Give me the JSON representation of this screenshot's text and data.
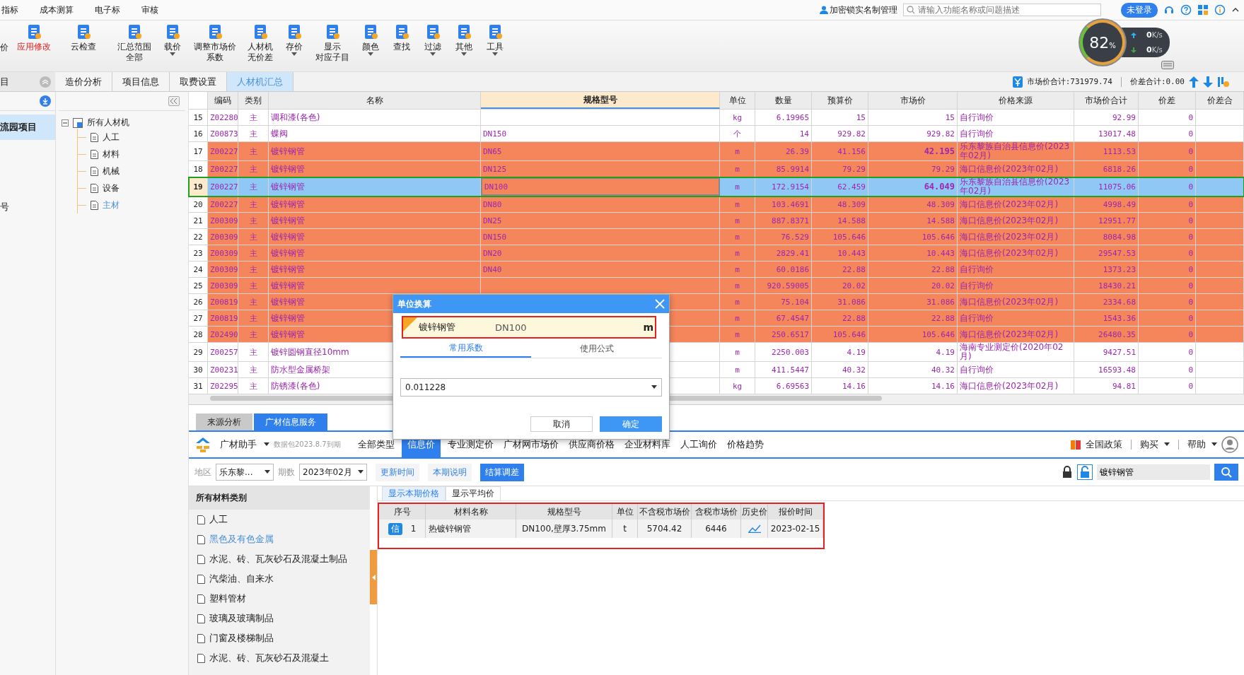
{
  "menu": [
    {
      "label": "指标"
    },
    {
      "label": "成本测算"
    },
    {
      "label": "电子标"
    },
    {
      "label": "审核"
    }
  ],
  "top_right": {
    "account": "加密锁实名制管理",
    "search_placeholder": "请输入功能名称或问题描述",
    "login": "未登录"
  },
  "toolbar": [
    {
      "lines": [
        "价"
      ],
      "active": false,
      "dropdown": false,
      "cut": true
    },
    {
      "lines": [
        "应用修改"
      ],
      "active": true,
      "dropdown": false,
      "cut": false
    },
    {
      "lines": [
        "云检查"
      ],
      "active": false,
      "dropdown": false,
      "cut": false
    },
    {
      "lines": [
        "汇总范围",
        "全部"
      ],
      "active": false,
      "dropdown": false,
      "cut": false
    },
    {
      "lines": [
        "载价"
      ],
      "active": false,
      "dropdown": true,
      "cut": false
    },
    {
      "lines": [
        "调整市场价",
        "系数"
      ],
      "active": false,
      "dropdown": false,
      "cut": false
    },
    {
      "lines": [
        "人材机",
        "无价差"
      ],
      "active": false,
      "dropdown": false,
      "cut": false
    },
    {
      "lines": [
        "存价"
      ],
      "active": false,
      "dropdown": true,
      "cut": false
    },
    {
      "lines": [
        "显示",
        "对应子目"
      ],
      "active": false,
      "dropdown": false,
      "cut": false
    },
    {
      "lines": [
        "颜色"
      ],
      "active": false,
      "dropdown": true,
      "cut": false
    },
    {
      "lines": [
        "查找"
      ],
      "active": false,
      "dropdown": false,
      "cut": false
    },
    {
      "lines": [
        "过滤"
      ],
      "active": false,
      "dropdown": true,
      "cut": false
    },
    {
      "lines": [
        "其他"
      ],
      "active": false,
      "dropdown": true,
      "cut": false
    },
    {
      "lines": [
        "工具"
      ],
      "active": false,
      "dropdown": true,
      "cut": false
    }
  ],
  "monitor": {
    "percent": "82",
    "percent_unit": "%",
    "upload": "0",
    "upload_unit": "K/s",
    "download": "0",
    "download_unit": "K/s"
  },
  "nav": {
    "header": "目",
    "selected_item": "流园项目",
    "other_item": "号"
  },
  "tabs": [
    {
      "label": "造价分析",
      "selected": false
    },
    {
      "label": "项目信息",
      "selected": false
    },
    {
      "label": "取费设置",
      "selected": false
    },
    {
      "label": "人材机汇总",
      "selected": true
    }
  ],
  "totals": {
    "market_total": "市场价合计:731979.74",
    "diff_total": "价差合计:0.00"
  },
  "tree": {
    "label": "所有人材机",
    "expanded": true,
    "children": [
      {
        "label": "人工",
        "selected": false
      },
      {
        "label": "材料",
        "selected": false
      },
      {
        "label": "机械",
        "selected": false
      },
      {
        "label": "设备",
        "selected": false
      },
      {
        "label": "主材",
        "selected": true
      }
    ]
  },
  "table": {
    "columns": [
      "编码",
      "类别",
      "名称",
      "规格型号",
      "单位",
      "数量",
      "预算价",
      "市场价",
      "价格来源",
      "市场价合计",
      "价差",
      "价差合"
    ],
    "rows": [
      {
        "no": "15",
        "code": "Z02280",
        "type": "主",
        "name": "调和漆(各色)",
        "unit": "kg",
        "qty": "6.19965",
        "budget": "15",
        "market": "15",
        "source": "自行询价",
        "total": "92.99",
        "diff": "0",
        "highlighted": false,
        "selected": false,
        "market_bold": false
      },
      {
        "no": "16",
        "code": "Z00873",
        "type": "主",
        "name": "蝶阀",
        "spec": "DN150",
        "unit": "个",
        "qty": "14",
        "budget": "929.82",
        "market": "929.82",
        "source": "自行询价",
        "total": "13017.48",
        "diff": "0",
        "highlighted": false,
        "selected": false,
        "market_bold": false
      },
      {
        "no": "17",
        "code": "Z00227",
        "type": "主",
        "name": "镀锌钢管",
        "spec": "DN65",
        "unit": "m",
        "qty": "26.39",
        "budget": "41.156",
        "market": "42.195",
        "source": "乐东黎族自治县信息价(2023年02月)",
        "total": "1113.53",
        "diff": "0",
        "highlighted": true,
        "selected": false,
        "market_bold": true
      },
      {
        "no": "18",
        "code": "Z00227",
        "type": "主",
        "name": "镀锌钢管",
        "spec": "DN125",
        "unit": "m",
        "qty": "85.9914",
        "budget": "79.29",
        "market": "79.29",
        "source": "海口信息价(2023年02月)",
        "total": "6818.26",
        "diff": "0",
        "highlighted": true,
        "selected": false,
        "market_bold": false
      },
      {
        "no": "19",
        "code": "Z00227",
        "type": "主",
        "name": "镀锌钢管",
        "spec": "DN100",
        "unit": "m",
        "qty": "172.9154",
        "budget": "62.459",
        "market": "64.049",
        "source": "乐东黎族自治县信息价(2023年02月)",
        "total": "11075.06",
        "diff": "0",
        "highlighted": true,
        "selected": true,
        "market_bold": true
      },
      {
        "no": "20",
        "code": "Z00227",
        "type": "主",
        "name": "镀锌钢管",
        "spec": "DN80",
        "unit": "m",
        "qty": "103.4691",
        "budget": "48.309",
        "market": "48.309",
        "source": "海口信息价(2023年02月)",
        "total": "4998.49",
        "diff": "0",
        "highlighted": true,
        "selected": false,
        "market_bold": false
      },
      {
        "no": "21",
        "code": "Z00309",
        "type": "主",
        "name": "镀锌钢管",
        "spec": "DN25",
        "unit": "m",
        "qty": "887.8371",
        "budget": "14.588",
        "market": "14.588",
        "source": "海口信息价(2023年02月)",
        "total": "12951.77",
        "diff": "0",
        "highlighted": true,
        "selected": false,
        "market_bold": false
      },
      {
        "no": "22",
        "code": "Z00309",
        "type": "主",
        "name": "镀锌钢管",
        "spec": "DN150",
        "unit": "m",
        "qty": "76.529",
        "budget": "105.646",
        "market": "105.646",
        "source": "海口信息价(2023年02月)",
        "total": "8084.98",
        "diff": "0",
        "highlighted": true,
        "selected": false,
        "market_bold": false
      },
      {
        "no": "23",
        "code": "Z00309",
        "type": "主",
        "name": "镀锌钢管",
        "spec": "DN20",
        "unit": "m",
        "qty": "2829.41",
        "budget": "10.443",
        "market": "10.443",
        "source": "海口信息价(2023年02月)",
        "total": "29547.53",
        "diff": "0",
        "highlighted": true,
        "selected": false,
        "market_bold": false
      },
      {
        "no": "24",
        "code": "Z00309",
        "type": "主",
        "name": "镀锌钢管",
        "spec": "DN40",
        "unit": "m",
        "qty": "60.0186",
        "budget": "22.88",
        "market": "22.88",
        "source": "自行询价",
        "total": "1373.23",
        "diff": "0",
        "highlighted": true,
        "selected": false,
        "market_bold": false
      },
      {
        "no": "25",
        "code": "Z00309",
        "type": "主",
        "name": "镀锌钢管",
        "unit": "m",
        "qty": "920.59005",
        "budget": "20.02",
        "market": "20.02",
        "source": "自行询价",
        "total": "18430.21",
        "diff": "0",
        "highlighted": true,
        "selected": false,
        "market_bold": false
      },
      {
        "no": "26",
        "code": "Z00819",
        "type": "主",
        "name": "镀锌钢管",
        "unit": "m",
        "qty": "75.104",
        "budget": "31.086",
        "market": "31.086",
        "source": "海口信息价(2023年02月)",
        "total": "2334.68",
        "diff": "0",
        "highlighted": true,
        "selected": false,
        "market_bold": false
      },
      {
        "no": "27",
        "code": "Z00819",
        "type": "主",
        "name": "镀锌钢管",
        "unit": "m",
        "qty": "67.4547",
        "budget": "22.88",
        "market": "22.88",
        "source": "自行询价",
        "total": "1543.36",
        "diff": "0",
        "highlighted": true,
        "selected": false,
        "market_bold": false
      },
      {
        "no": "28",
        "code": "Z02490",
        "type": "主",
        "name": "镀锌钢管",
        "unit": "m",
        "qty": "250.6517",
        "budget": "105.646",
        "market": "105.646",
        "source": "海口信息价(2023年02月)",
        "total": "26480.35",
        "diff": "0",
        "highlighted": true,
        "selected": false,
        "market_bold": false
      },
      {
        "no": "29",
        "code": "Z00257",
        "type": "主",
        "name": "镀锌圆钢直径10mm",
        "unit": "m",
        "qty": "2250.003",
        "budget": "4.19",
        "market": "4.19",
        "source": "海南专业测定价(2020年02月)",
        "total": "9427.51",
        "diff": "0",
        "highlighted": false,
        "selected": false,
        "market_bold": false
      },
      {
        "no": "30",
        "code": "Z00231",
        "type": "主",
        "name": "防水型金属桥架",
        "unit": "m",
        "qty": "411.5447",
        "budget": "40.32",
        "market": "40.32",
        "source": "自行询价",
        "total": "16593.48",
        "diff": "0",
        "highlighted": false,
        "selected": false,
        "market_bold": false
      },
      {
        "no": "31",
        "code": "Z02295",
        "type": "主",
        "name": "防锈漆(各色)",
        "unit": "kg",
        "qty": "6.69563",
        "budget": "14.16",
        "market": "14.16",
        "source": "海口信息价(2023年02月)",
        "total": "94.81",
        "diff": "0",
        "highlighted": false,
        "selected": false,
        "market_bold": false
      }
    ]
  },
  "dialog": {
    "title": "单位换算",
    "item_name": "镀锌钢管",
    "item_spec": "DN100",
    "item_unit": "m",
    "tabs": [
      {
        "label": "常用系数",
        "selected": true
      },
      {
        "label": "使用公式",
        "selected": false
      }
    ],
    "value": "0.011228",
    "buttons": [
      {
        "label": "取消",
        "primary": false
      },
      {
        "label": "确定",
        "primary": true
      }
    ]
  },
  "bottom": {
    "tabs": [
      {
        "label": "来源分析",
        "selected": false
      },
      {
        "label": "广材信息服务",
        "selected": true
      }
    ],
    "assistant": "广材助手",
    "package": "数据包2023.8.7到期",
    "price_tabs": [
      {
        "label": "全部类型",
        "selected": false
      },
      {
        "label": "信息价",
        "selected": true
      },
      {
        "label": "专业测定价",
        "selected": false
      },
      {
        "label": "广材网市场价",
        "selected": false
      },
      {
        "label": "供应商价格",
        "selected": false
      },
      {
        "label": "企业材料库",
        "selected": false
      },
      {
        "label": "人工询价",
        "selected": false
      },
      {
        "label": "价格趋势",
        "selected": false
      }
    ],
    "links": [
      {
        "label": "全国政策",
        "dropdown": false
      },
      {
        "label": "购买",
        "dropdown": true
      },
      {
        "label": "帮助",
        "dropdown": true
      }
    ],
    "region_label": "地区",
    "region": "乐东黎...",
    "period_label": "期数",
    "period": "2023年02月",
    "actions": [
      {
        "label": "更新时间",
        "selected": false
      },
      {
        "label": "本期说明",
        "selected": false
      },
      {
        "label": "结算调差",
        "selected": true
      }
    ],
    "search": "镀锌钢管",
    "categories_header": "所有材料类别",
    "categories": [
      {
        "label": "人工",
        "selected": false
      },
      {
        "label": "黑色及有色金属",
        "selected": true
      },
      {
        "label": "水泥、砖、瓦灰砂石及混凝土制品",
        "selected": false
      },
      {
        "label": "汽柴油、自来水",
        "selected": false
      },
      {
        "label": "塑料管材",
        "selected": false
      },
      {
        "label": "玻璃及玻璃制品",
        "selected": false
      },
      {
        "label": "门窗及楼梯制品",
        "selected": false
      },
      {
        "label": "水泥、砖、瓦灰砂石及混凝土",
        "selected": false
      }
    ],
    "view_tabs": [
      {
        "label": "显示本期价格",
        "selected": true
      },
      {
        "label": "显示平均价",
        "selected": false
      }
    ],
    "result_columns": [
      "序号",
      "材料名称",
      "规格型号",
      "单位",
      "不含税市场价",
      "含税市场价",
      "历史价",
      "报价时间"
    ],
    "results": [
      {
        "badge": "信",
        "no": "1",
        "name": "热镀锌钢管",
        "spec": "DN100,壁厚3.75mm",
        "unit": "t",
        "price_ex_tax": "5704.42",
        "price_in_tax": "6446",
        "date": "2023-02-15"
      }
    ]
  }
}
